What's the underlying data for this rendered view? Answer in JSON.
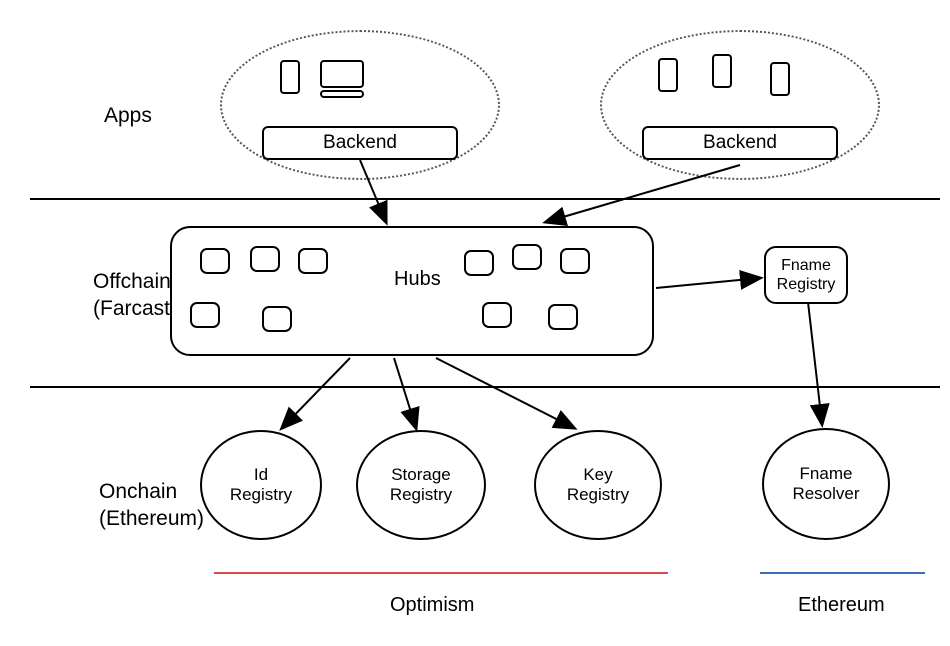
{
  "layers": {
    "apps": "Apps",
    "offchain_line1": "Offchain",
    "offchain_line2": "(Farcaster)",
    "onchain_line1": "Onchain",
    "onchain_line2": "(Ethereum)"
  },
  "apps": {
    "backend_left": "Backend",
    "backend_right": "Backend"
  },
  "hubs": {
    "label": "Hubs"
  },
  "fname_registry": {
    "line1": "Fname",
    "line2": "Registry"
  },
  "registries": {
    "id": {
      "line1": "Id",
      "line2": "Registry"
    },
    "storage": {
      "line1": "Storage",
      "line2": "Registry"
    },
    "key": {
      "line1": "Key",
      "line2": "Registry"
    },
    "fname_resolver": {
      "line1": "Fname",
      "line2": "Resolver"
    }
  },
  "chains": {
    "optimism": "Optimism",
    "ethereum": "Ethereum"
  },
  "colors": {
    "optimism_line": "#d94a4a",
    "ethereum_line": "#3a6fb7"
  }
}
